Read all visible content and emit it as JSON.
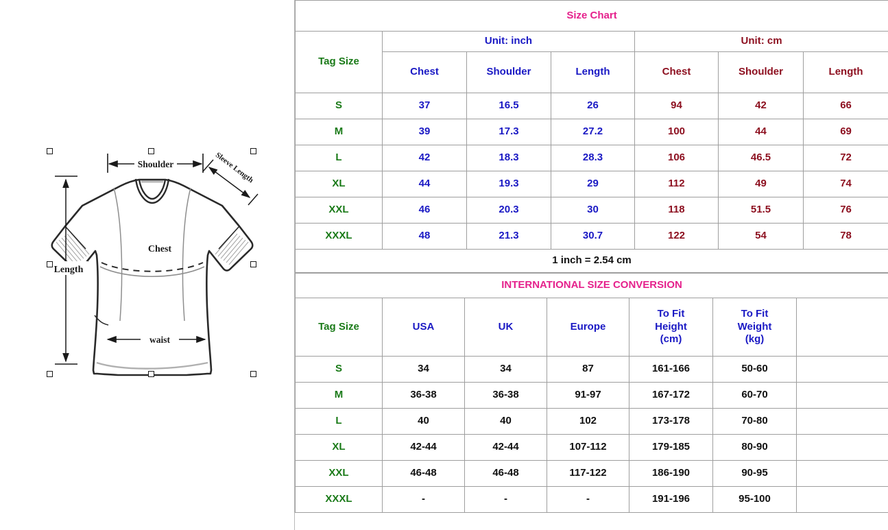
{
  "title": "Size Chart",
  "diagram": {
    "name": "t-shirt-measurement-diagram",
    "labels": {
      "shoulder": "Shoulder",
      "sleeve": "Sleeve Length",
      "chest": "Chest",
      "length": "Length",
      "waist": "waist"
    }
  },
  "size_table": {
    "tag_header": "Tag Size",
    "unit_inch": "Unit: inch",
    "unit_cm": "Unit: cm",
    "columns_inch": [
      "Chest",
      "Shoulder",
      "Length"
    ],
    "columns_cm": [
      "Chest",
      "Shoulder",
      "Length"
    ],
    "rows": [
      {
        "tag": "S",
        "inch": [
          "37",
          "16.5",
          "26"
        ],
        "cm": [
          "94",
          "42",
          "66"
        ]
      },
      {
        "tag": "M",
        "inch": [
          "39",
          "17.3",
          "27.2"
        ],
        "cm": [
          "100",
          "44",
          "69"
        ]
      },
      {
        "tag": "L",
        "inch": [
          "42",
          "18.3",
          "28.3"
        ],
        "cm": [
          "106",
          "46.5",
          "72"
        ]
      },
      {
        "tag": "XL",
        "inch": [
          "44",
          "19.3",
          "29"
        ],
        "cm": [
          "112",
          "49",
          "74"
        ]
      },
      {
        "tag": "XXL",
        "inch": [
          "46",
          "20.3",
          "30"
        ],
        "cm": [
          "118",
          "51.5",
          "76"
        ]
      },
      {
        "tag": "XXXL",
        "inch": [
          "48",
          "21.3",
          "30.7"
        ],
        "cm": [
          "122",
          "54",
          "78"
        ]
      }
    ],
    "conversion_note": "1 inch = 2.54 cm"
  },
  "international": {
    "banner": "INTERNATIONAL SIZE CONVERSION",
    "tag_header": "Tag Size",
    "columns": [
      "USA",
      "UK",
      "Europe",
      "To Fit Height (cm)",
      "To Fit Weight (kg)"
    ],
    "column_height_l1": "To Fit",
    "column_height_l2": "Height",
    "column_height_l3": "(cm)",
    "column_weight_l1": "To Fit",
    "column_weight_l2": "Weight",
    "column_weight_l3": "(kg)",
    "rows": [
      {
        "tag": "S",
        "values": [
          "34",
          "34",
          "87",
          "161-166",
          "50-60"
        ]
      },
      {
        "tag": "M",
        "values": [
          "36-38",
          "36-38",
          "91-97",
          "167-172",
          "60-70"
        ]
      },
      {
        "tag": "L",
        "values": [
          "40",
          "40",
          "102",
          "173-178",
          "70-80"
        ]
      },
      {
        "tag": "XL",
        "values": [
          "42-44",
          "42-44",
          "107-112",
          "179-185",
          "80-90"
        ]
      },
      {
        "tag": "XXL",
        "values": [
          "46-48",
          "46-48",
          "117-122",
          "186-190",
          "90-95"
        ]
      },
      {
        "tag": "XXXL",
        "values": [
          "-",
          "-",
          "-",
          "191-196",
          "95-100"
        ]
      }
    ]
  },
  "colors": {
    "title_pink": "#e5218c",
    "inch_blue": "#1a19c4",
    "cm_darkred": "#8d1020",
    "tag_green": "#1a7a18",
    "value_black": "#111111",
    "grid_gray": "#9e9e9e"
  }
}
